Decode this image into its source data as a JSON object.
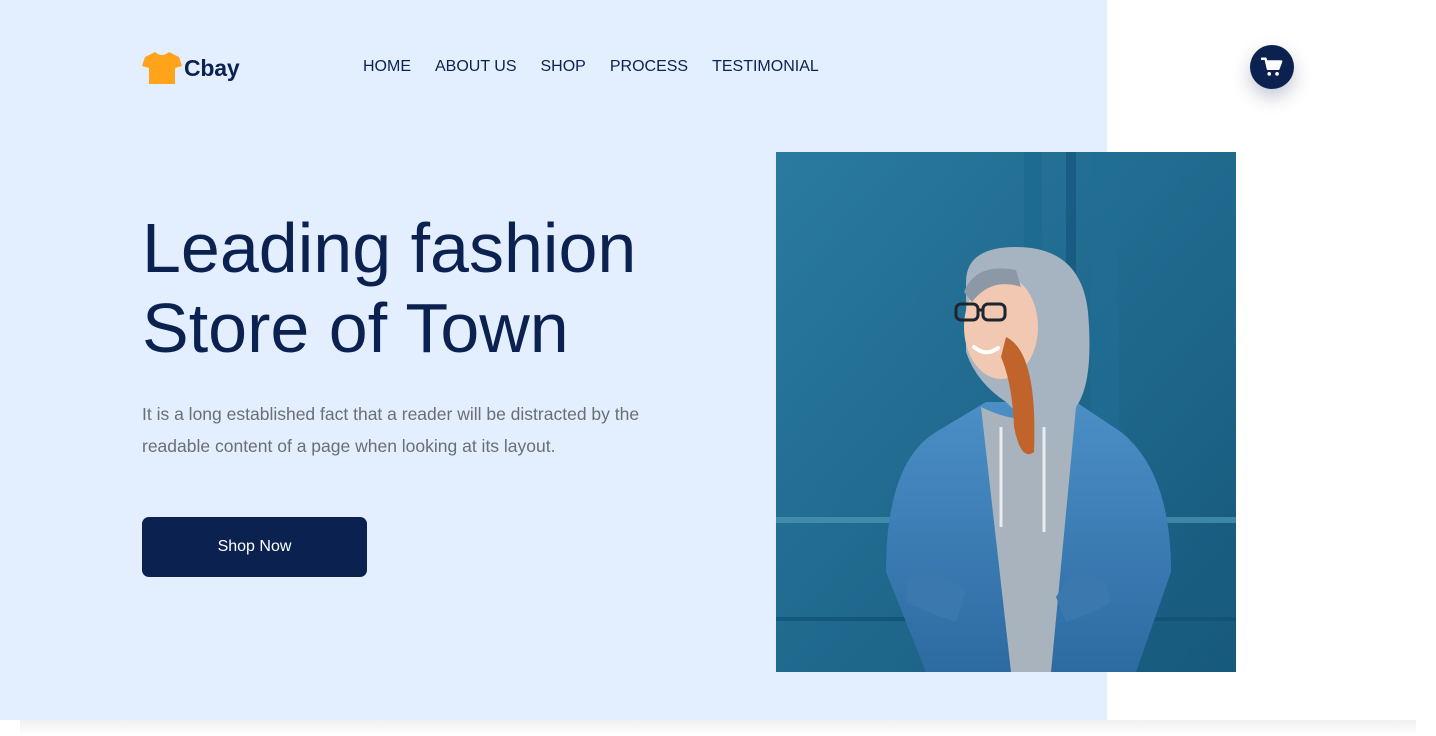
{
  "brand": {
    "name": "Cbay",
    "accent_color": "#ffa31a",
    "icon": "tshirt-icon"
  },
  "nav": {
    "items": [
      {
        "label": "HOME"
      },
      {
        "label": "ABOUT US"
      },
      {
        "label": "SHOP"
      },
      {
        "label": "PROCESS"
      },
      {
        "label": "TESTIMONIAL"
      }
    ]
  },
  "cart": {
    "icon": "cart-icon"
  },
  "hero": {
    "headline_line1": "Leading fashion",
    "headline_line2": "Store of Town",
    "description": "It is a long established fact that a reader will be distracted by the readable content of a page when looking at its layout.",
    "cta_label": "Shop Now",
    "image": "woman-in-denim-jacket-photo"
  },
  "colors": {
    "primary": "#0b2150",
    "hero_background": "#e3efff",
    "body_text": "#6b6e75"
  }
}
